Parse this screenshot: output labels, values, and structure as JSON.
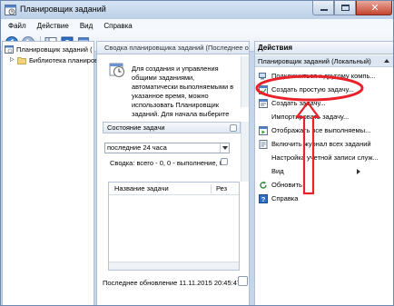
{
  "window": {
    "title": "Планировщик заданий"
  },
  "menu": [
    "Файл",
    "Действие",
    "Вид",
    "Справка"
  ],
  "toolbar": {
    "icons": [
      "back-icon",
      "forward-icon",
      "console-tree-icon",
      "help-icon",
      "properties-icon"
    ]
  },
  "tree": {
    "items": [
      {
        "label": "Планировщик заданий (",
        "icon": "scheduler-icon"
      },
      {
        "label": "Библиотека планиров",
        "icon": "folder-icon"
      }
    ]
  },
  "middle": {
    "header": "Сводка планировщика заданий (Последнее обнов",
    "overview": "Для создания и управления общими заданиями, автоматически выполняемыми в указанное время, можно использовать Планировщик заданий. Для начала выберите команду в",
    "status_section": "Состояние задачи",
    "period": "последние 24 часа",
    "summary": "Сводка: всего - 0, 0 - выполнение, 0 -",
    "columns": [
      "Название задачи",
      "Рез"
    ],
    "last_update": "Последнее обновление 11.11.2015 20:45:47"
  },
  "actions": {
    "header": "Действия",
    "group": "Планировщик заданий (Локальный)",
    "items": [
      {
        "label": "Подключиться к другому компь...",
        "icon": "connect-icon"
      },
      {
        "label": "Создать простую задачу...",
        "icon": "create-basic-task-icon"
      },
      {
        "label": "Создать задачу...",
        "icon": "create-task-icon"
      },
      {
        "label": "Импортировать задачу...",
        "icon": "import-icon"
      },
      {
        "label": "Отображать все выполняемы...",
        "icon": "running-tasks-icon"
      },
      {
        "label": "Включить журнал всех заданий",
        "icon": "log-icon"
      },
      {
        "label": "Настройка учетной записи служ...",
        "icon": "account-icon"
      },
      {
        "label": "Вид",
        "icon": "view-icon"
      },
      {
        "label": "Обновить",
        "icon": "refresh-icon"
      },
      {
        "label": "Справка",
        "icon": "help-icon"
      }
    ]
  },
  "colors": {
    "annotation": "#e8212a",
    "window_frame": "#c5d6ea"
  }
}
